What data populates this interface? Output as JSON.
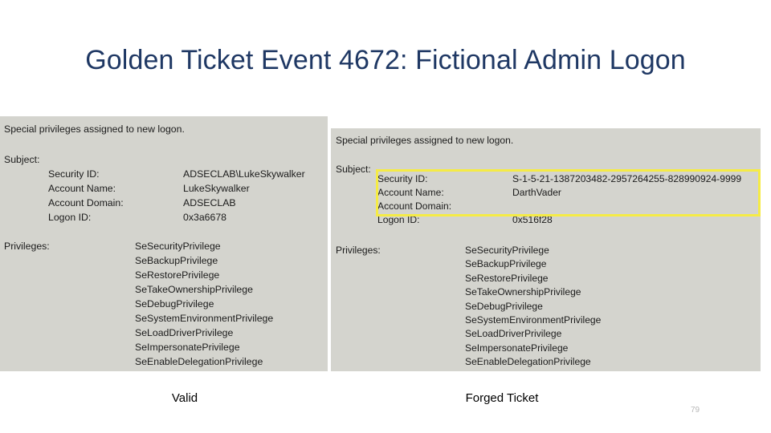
{
  "slide": {
    "title": "Golden Ticket Event 4672: Fictional Admin Logon",
    "page_number": "79",
    "title_color": "#1f3864",
    "highlight_color": "#f5eb45",
    "panel_background": "#d4d4ce"
  },
  "panels": [
    {
      "id": "valid",
      "caption": "Valid",
      "header": "Special privileges assigned to new logon.",
      "subject_label": "Subject:",
      "privileges_label": "Privileges:",
      "fields": [
        {
          "key": "Security ID:",
          "value": "ADSECLAB\\LukeSkywalker"
        },
        {
          "key": "Account Name:",
          "value": "LukeSkywalker"
        },
        {
          "key": "Account Domain:",
          "value": "ADSECLAB"
        },
        {
          "key": "Logon ID:",
          "value": "0x3a6678"
        }
      ],
      "privileges": [
        "SeSecurityPrivilege",
        "SeBackupPrivilege",
        "SeRestorePrivilege",
        "SeTakeOwnershipPrivilege",
        "SeDebugPrivilege",
        "SeSystemEnvironmentPrivilege",
        "SeLoadDriverPrivilege",
        "SeImpersonatePrivilege",
        "SeEnableDelegationPrivilege"
      ]
    },
    {
      "id": "forged",
      "caption": "Forged Ticket",
      "header": "Special privileges assigned to new logon.",
      "subject_label": "Subject:",
      "privileges_label": "Privileges:",
      "fields": [
        {
          "key": "Security ID:",
          "value": "S-1-5-21-1387203482-2957264255-828990924-9999"
        },
        {
          "key": "Account Name:",
          "value": "DarthVader"
        },
        {
          "key": "Account Domain:",
          "value": ""
        },
        {
          "key": "Logon ID:",
          "value": "0x516f28"
        }
      ],
      "privileges": [
        "SeSecurityPrivilege",
        "SeBackupPrivilege",
        "SeRestorePrivilege",
        "SeTakeOwnershipPrivilege",
        "SeDebugPrivilege",
        "SeSystemEnvironmentPrivilege",
        "SeLoadDriverPrivilege",
        "SeImpersonatePrivilege",
        "SeEnableDelegationPrivilege"
      ]
    }
  ]
}
